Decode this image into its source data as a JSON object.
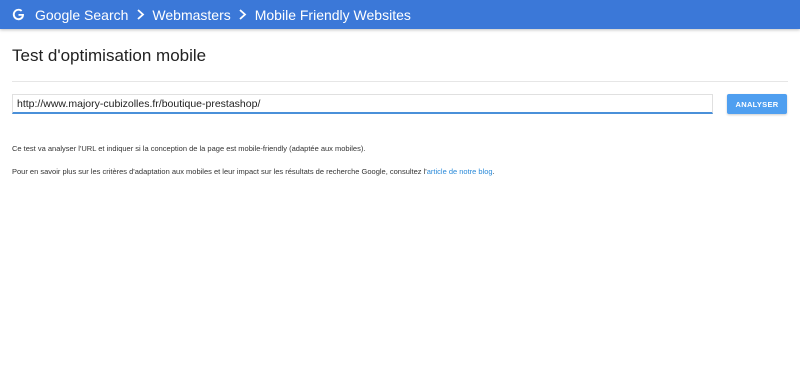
{
  "header": {
    "breadcrumbs": [
      "Google Search",
      "Webmasters",
      "Mobile Friendly Websites"
    ],
    "logo_icon": "google-g-icon",
    "separator_icon": "chevron-right-icon",
    "bar_color": "#3b78d8"
  },
  "main": {
    "title": "Test d'optimisation mobile",
    "url_value": "http://www.majory-cubizolles.fr/boutique-prestashop/",
    "analyze_label": "ANALYSER",
    "description_1": "Ce test va analyser l'URL et indiquer si la conception de la page est mobile-friendly (adaptée aux mobiles).",
    "description_2_prefix": "Pour en savoir plus sur les critères d'adaptation aux mobiles et leur impact sur les résultats de recherche Google, consultez l'",
    "blog_link_label": "article de notre blog",
    "description_2_suffix": ".",
    "accent_color": "#4f9ff0",
    "link_color": "#2a8ad9"
  }
}
